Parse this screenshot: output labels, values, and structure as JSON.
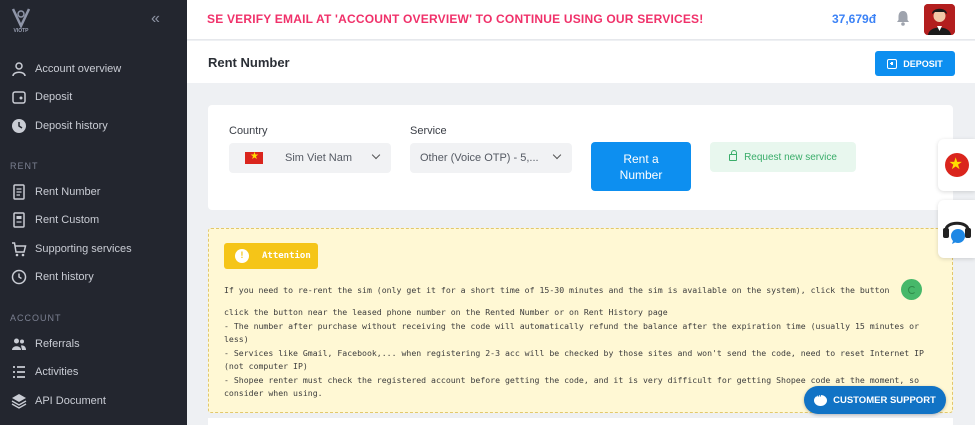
{
  "app": {
    "logo_text": "VIOTP"
  },
  "sidebar": {
    "items_top": [
      {
        "label": "Account overview",
        "icon": "user-icon"
      },
      {
        "label": "Deposit",
        "icon": "wallet-icon"
      },
      {
        "label": "Deposit history",
        "icon": "clock-icon"
      }
    ],
    "section_rent": "RENT",
    "items_rent": [
      {
        "label": "Rent Number",
        "icon": "document-icon"
      },
      {
        "label": "Rent Custom",
        "icon": "document-list-icon"
      },
      {
        "label": "Supporting services",
        "icon": "cart-icon"
      },
      {
        "label": "Rent history",
        "icon": "history-icon"
      }
    ],
    "section_account": "ACCOUNT",
    "items_account": [
      {
        "label": "Referrals",
        "icon": "users-icon"
      },
      {
        "label": "Activities",
        "icon": "list-icon"
      },
      {
        "label": "API Document",
        "icon": "layers-icon"
      }
    ]
  },
  "topbar": {
    "marquee": "SE VERIFY EMAIL AT 'ACCOUNT OVERVIEW' TO CONTINUE USING OUR SERVICES!",
    "balance": "37,679đ"
  },
  "page": {
    "title": "Rent Number",
    "deposit_label": "DEPOSIT"
  },
  "rent_form": {
    "country_label": "Country",
    "country_value": "Sim Viet Nam",
    "service_label": "Service",
    "service_value": "Other (Voice OTP) - 5,...",
    "rent_button": "Rent a Number",
    "request_button": "Request new service"
  },
  "attention": {
    "badge": "Attention",
    "lines": [
      "If you need to re-rent the sim (only get it for a short time of 15-30 minutes and the sim is available on the system), click the button",
      "click the button near the leased phone number on the Rented Number or on Rent History page",
      "- The number after purchase without receiving the code will automatically refund the balance after the expiration time (usually 15 minutes or",
      "less)",
      "- Services like Gmail, Facebook,... when registering 2-3 acc will be checked by those sites and won't send the code, need to reset Internet IP",
      "(not computer IP)",
      "- Shopee renter must check the registered account before getting the code, and it is very difficult for getting Shopee code at the moment, so",
      "consider when using."
    ]
  },
  "support": {
    "label": "CUSTOMER SUPPORT"
  },
  "colors": {
    "primary": "#0d8ff0",
    "sidebar_bg": "#23262f",
    "alert_text": "#f0316a",
    "attention": "#f5c518"
  }
}
